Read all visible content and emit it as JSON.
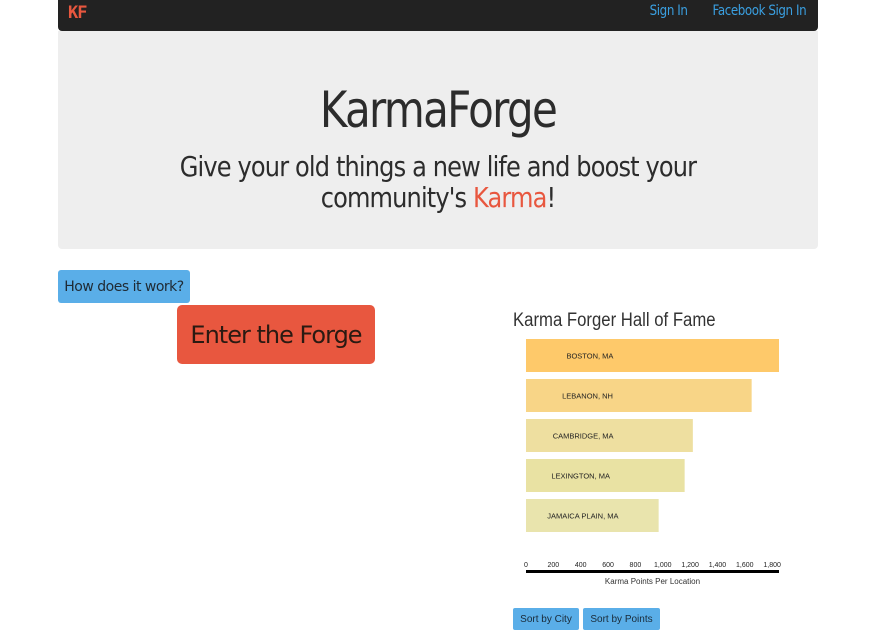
{
  "navbar": {
    "brand": "KF",
    "links": [
      "Sign In",
      "Facebook Sign In"
    ]
  },
  "hero": {
    "title": "KarmaForge",
    "subtitle_before": "Give your old things a new life and boost your community's ",
    "subtitle_highlight": "Karma",
    "subtitle_after": "!"
  },
  "buttons": {
    "how": "How does it work?",
    "forge": "Enter the Forge",
    "sort_city": "Sort by City",
    "sort_points": "Sort by Points"
  },
  "chart_data": {
    "type": "bar",
    "orientation": "horizontal",
    "title": "Karma Forger Hall of Fame",
    "xlabel": "Karma Points Per Location",
    "categories": [
      "BOSTON, MA",
      "LEBANON, NH",
      "CAMBRIDGE, MA",
      "LEXINGTON, MA",
      "JAMAICA PLAIN, MA"
    ],
    "values": [
      1850,
      1650,
      1220,
      1160,
      970
    ],
    "xlim": [
      0,
      1850
    ],
    "xticks": [
      "0",
      "200",
      "400",
      "600",
      "800",
      "1,000",
      "1,200",
      "1,400",
      "1,600",
      "1,800"
    ],
    "xtick_values": [
      0,
      200,
      400,
      600,
      800,
      1000,
      1200,
      1400,
      1600,
      1800
    ],
    "colors": [
      "#fec96a",
      "#f8d587",
      "#eedfa0",
      "#e9e2a3",
      "#e9e4ad"
    ],
    "grid": false,
    "legend": "none"
  },
  "colors": {
    "brand_accent": "#e8573f",
    "link_blue": "#3a9fe0",
    "button_blue": "#5aaee8",
    "navbar_bg": "#222222",
    "hero_bg": "#eeeeee"
  }
}
